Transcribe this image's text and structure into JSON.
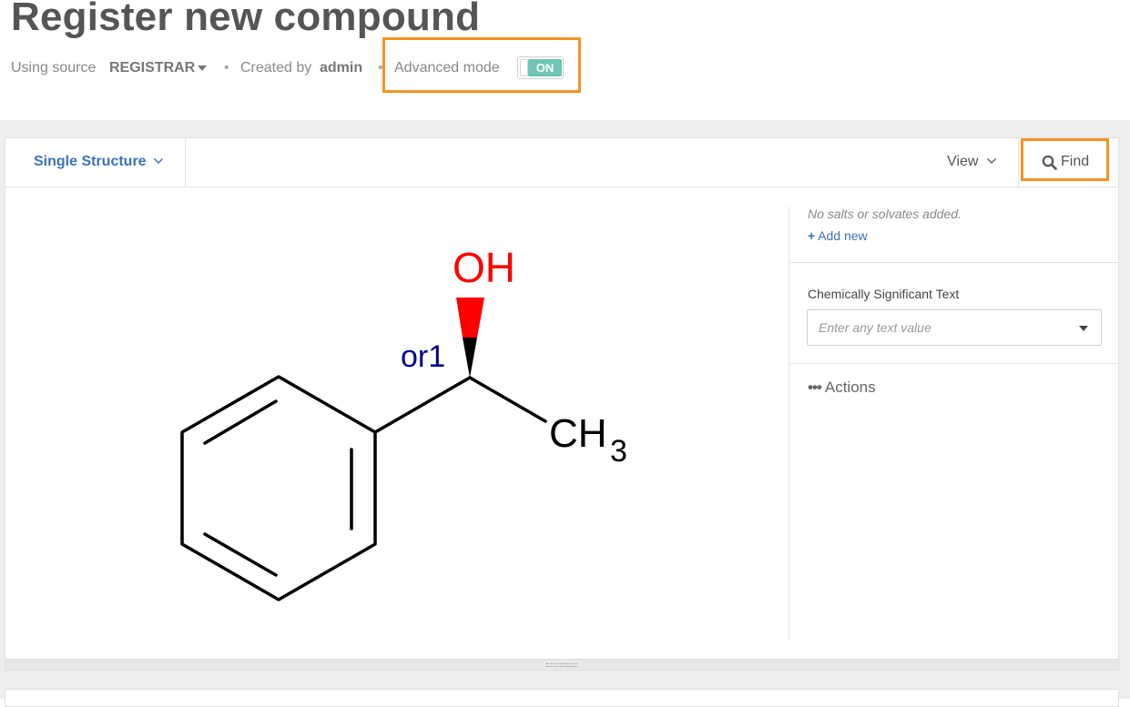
{
  "header": {
    "title": "Register new compound",
    "source_label": "Using source",
    "source_value": "REGISTRAR",
    "separator": "•",
    "created_label": "Created by",
    "created_user": "admin",
    "advanced_mode_label": "Advanced mode",
    "advanced_mode_state": "ON"
  },
  "toolbar": {
    "structure_mode": "Single Structure",
    "view_label": "View",
    "find_label": "Find"
  },
  "structure": {
    "oh_label": "OH",
    "stereo_label": "or1",
    "ch_label": "CH",
    "ch_subscript": "3"
  },
  "right_pane": {
    "no_salts_text": "No salts or solvates added.",
    "add_new_label": "Add new",
    "cst_label": "Chemically Significant Text",
    "cst_placeholder": "Enter any text value",
    "actions_label": "Actions"
  },
  "colors": {
    "accent_blue": "#3b73b9",
    "highlight_orange": "#f7931e",
    "toggle_on": "#6fc6b6",
    "oxygen_red": "#ff0000",
    "stereo_navy": "#00008b"
  }
}
